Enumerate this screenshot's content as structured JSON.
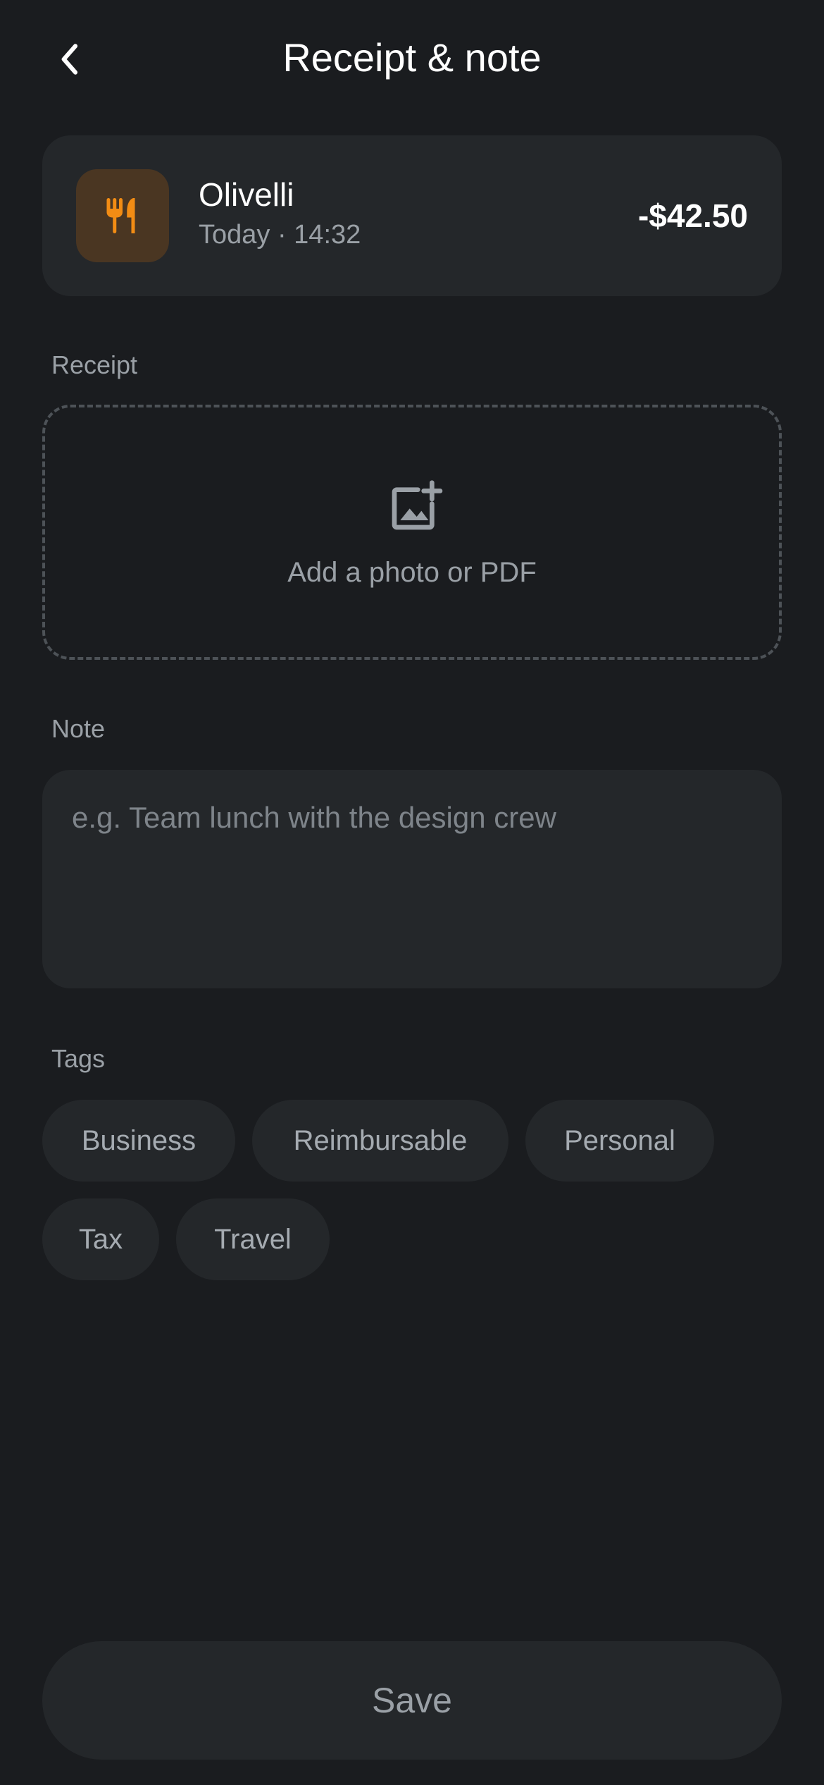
{
  "header": {
    "title": "Receipt & note",
    "back_icon": "chevron-left-icon"
  },
  "transaction": {
    "merchant": "Olivelli",
    "meta": "Today · 14:32",
    "amount": "-$42.50",
    "icon": "fork-knife-icon",
    "icon_color": "#F28C14",
    "icon_bg": "#4A3622"
  },
  "receipt": {
    "label": "Receipt",
    "upload_text": "Add a photo or PDF",
    "icon": "add-photo-icon"
  },
  "note": {
    "label": "Note",
    "placeholder": "e.g. Team lunch with the design crew",
    "value": ""
  },
  "tags": {
    "label": "Tags",
    "items": [
      {
        "label": "Business"
      },
      {
        "label": "Reimbursable"
      },
      {
        "label": "Personal"
      },
      {
        "label": "Tax"
      },
      {
        "label": "Travel"
      }
    ]
  },
  "footer": {
    "save_label": "Save"
  },
  "colors": {
    "background": "#1A1C1F",
    "surface": "#24272A",
    "text_primary": "#FFFFFF",
    "text_secondary": "#9AA0A6",
    "accent": "#F28C14"
  }
}
